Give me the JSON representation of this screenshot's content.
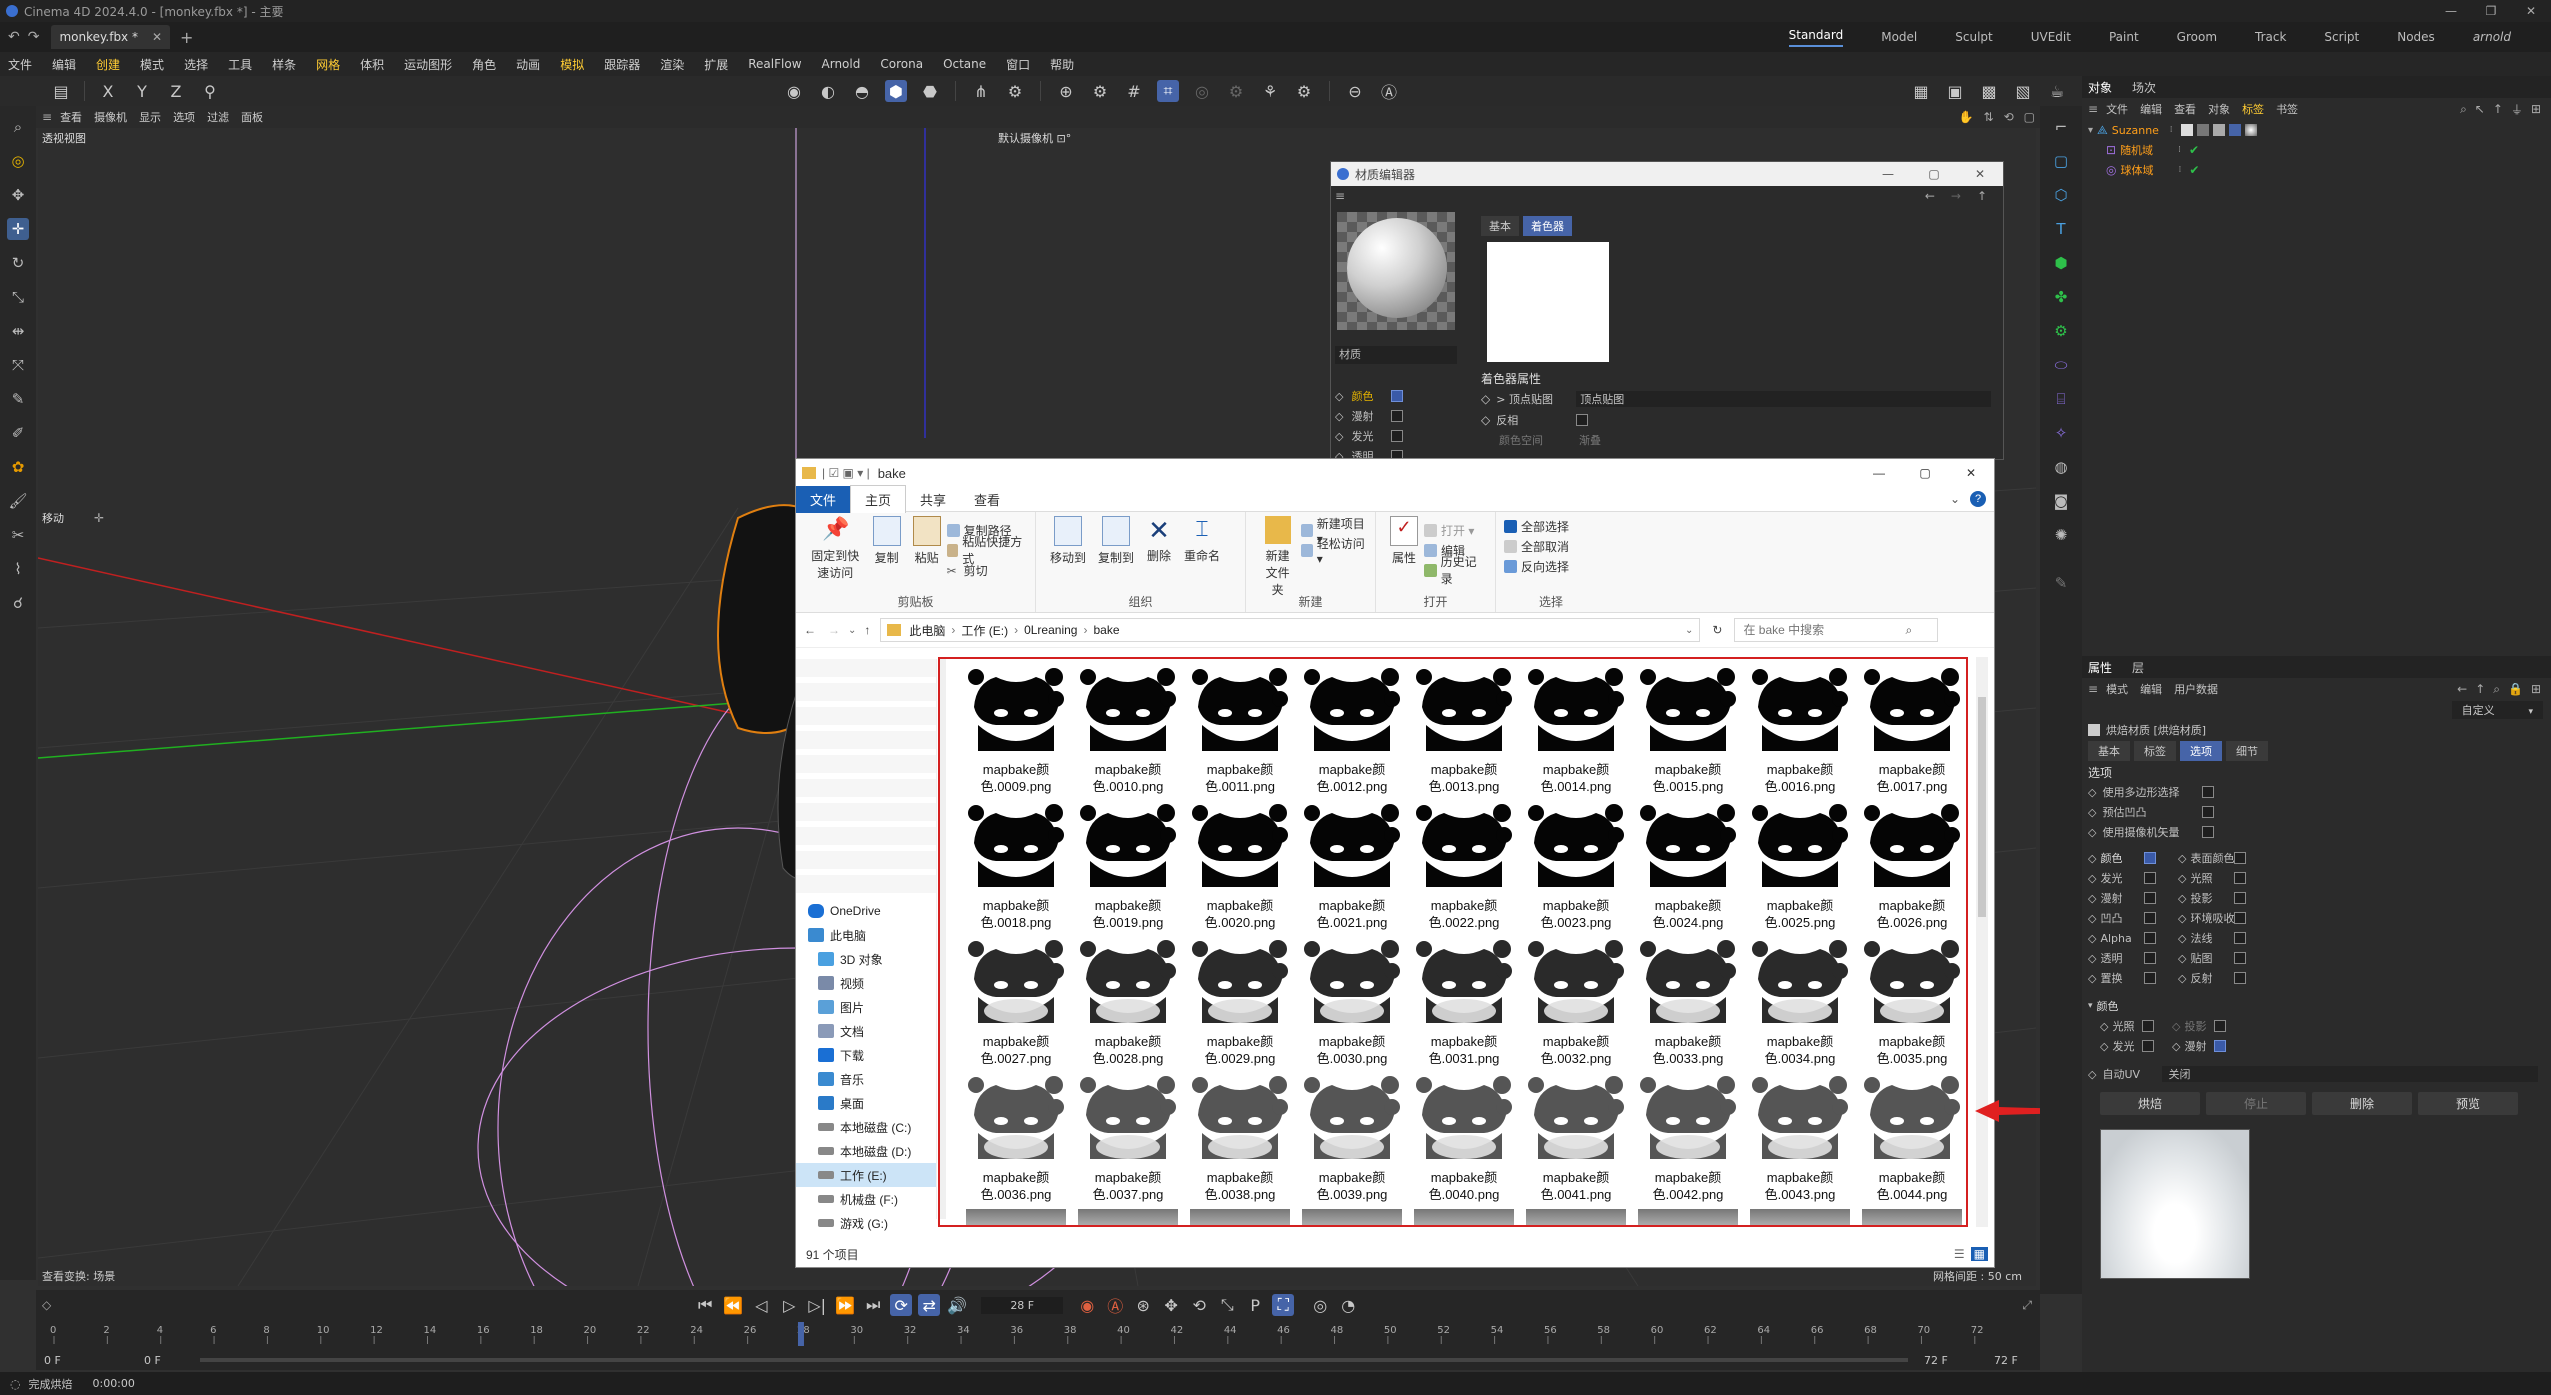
{
  "app": {
    "title": "Cinema 4D 2024.4.0 - [monkey.fbx *] - 主要",
    "doc_tab": "monkey.fbx *",
    "layouts": [
      "Standard",
      "Model",
      "Sculpt",
      "UVEdit",
      "Paint",
      "Groom",
      "Track",
      "Script",
      "Nodes",
      "arnold"
    ],
    "menu": [
      "文件",
      "编辑",
      "创建",
      "模式",
      "选择",
      "工具",
      "样条",
      "网格",
      "体积",
      "运动图形",
      "角色",
      "动画",
      "模拟",
      "跟踪器",
      "渲染",
      "扩展",
      "RealFlow",
      "Arnold",
      "Corona",
      "Octane",
      "窗口",
      "帮助"
    ]
  },
  "toolbar": {
    "axes": [
      "X",
      "Y",
      "Z"
    ]
  },
  "viewport": {
    "menu": [
      "查看",
      "摄像机",
      "显示",
      "选项",
      "过滤",
      "面板"
    ],
    "label": "透视视图",
    "camera": "默认摄像机 ⊡°",
    "move_label": "移动",
    "footer": "查看变换: 场景",
    "grid_spacing": "网格间距 : 50 cm"
  },
  "timeline": {
    "frame_field": "28 F",
    "start": "0 F",
    "start2": "0 F",
    "end": "72 F",
    "end2": "72 F",
    "ticks": [
      "0",
      "2",
      "4",
      "6",
      "8",
      "10",
      "12",
      "14",
      "16",
      "18",
      "20",
      "22",
      "24",
      "26",
      "28",
      "30",
      "32",
      "34",
      "36",
      "38",
      "40",
      "42",
      "44",
      "46",
      "48",
      "50",
      "52",
      "54",
      "56",
      "58",
      "60",
      "62",
      "64",
      "66",
      "68",
      "70",
      "72"
    ],
    "current": 28
  },
  "status": {
    "text": "完成烘焙",
    "time": "0:00:00"
  },
  "material_editor": {
    "title": "材质编辑器",
    "name": "材质",
    "tabs": [
      "基本",
      "着色器"
    ],
    "channels": [
      {
        "label": "颜色",
        "checked": true
      },
      {
        "label": "漫射",
        "checked": false
      },
      {
        "label": "发光",
        "checked": false
      },
      {
        "label": "透明",
        "checked": false
      }
    ],
    "section": "着色器属性",
    "shader_label": "> 顶点贴图",
    "shader_value": "顶点贴图",
    "invert_label": "反相",
    "extra_label": "颜色空间",
    "extra_value": "渐叠"
  },
  "explorer": {
    "title": "bake",
    "tabs": [
      "文件",
      "主页",
      "共享",
      "查看"
    ],
    "ribbon": {
      "clipboard": {
        "title": "剪贴板",
        "pin": "固定到快速访问",
        "copy": "复制",
        "paste": "粘贴",
        "copy_path": "复制路径",
        "paste_shortcut": "粘贴快捷方式",
        "cut": "剪切"
      },
      "organize": {
        "title": "组织",
        "move_to": "移动到",
        "copy_to": "复制到",
        "delete": "删除",
        "rename": "重命名"
      },
      "new": {
        "title": "新建",
        "new_folder": "新建文件夹",
        "new_item": "新建项目 ▾",
        "easy_access": "轻松访问 ▾"
      },
      "open": {
        "title": "打开",
        "properties": "属性",
        "open": "打开 ▾",
        "edit": "编辑",
        "history": "历史记录"
      },
      "select": {
        "title": "选择",
        "select_all": "全部选择",
        "select_none": "全部取消",
        "invert": "反向选择"
      }
    },
    "breadcrumb": [
      "此电脑",
      "工作 (E:)",
      "0Lreaning",
      "bake"
    ],
    "search_placeholder": "在 bake 中搜索",
    "nav": [
      "OneDrive",
      "此电脑",
      "3D 对象",
      "视频",
      "图片",
      "文档",
      "下载",
      "音乐",
      "桌面",
      "本地磁盘 (C:)",
      "本地磁盘 (D:)",
      "工作 (E:)",
      "机械盘 (F:)",
      "游戏 (G:)"
    ],
    "item_count": "91 个项目",
    "files": [
      "mapbake颜色.0009.png",
      "mapbake颜色.0010.png",
      "mapbake颜色.0011.png",
      "mapbake颜色.0012.png",
      "mapbake颜色.0013.png",
      "mapbake颜色.0014.png",
      "mapbake颜色.0015.png",
      "mapbake颜色.0016.png",
      "mapbake颜色.0017.png",
      "mapbake颜色.0018.png",
      "mapbake颜色.0019.png",
      "mapbake颜色.0020.png",
      "mapbake颜色.0021.png",
      "mapbake颜色.0022.png",
      "mapbake颜色.0023.png",
      "mapbake颜色.0024.png",
      "mapbake颜色.0025.png",
      "mapbake颜色.0026.png",
      "mapbake颜色.0027.png",
      "mapbake颜色.0028.png",
      "mapbake颜色.0029.png",
      "mapbake颜色.0030.png",
      "mapbake颜色.0031.png",
      "mapbake颜色.0032.png",
      "mapbake颜色.0033.png",
      "mapbake颜色.0034.png",
      "mapbake颜色.0035.png",
      "mapbake颜色.0036.png",
      "mapbake颜色.0037.png",
      "mapbake颜色.0038.png",
      "mapbake颜色.0039.png",
      "mapbake颜色.0040.png",
      "mapbake颜色.0041.png",
      "mapbake颜色.0042.png",
      "mapbake颜色.0043.png",
      "mapbake颜色.0044.png"
    ]
  },
  "object_manager": {
    "tabs": [
      "对象",
      "场次"
    ],
    "menu": [
      "文件",
      "编辑",
      "查看",
      "对象",
      "标签",
      "书签"
    ],
    "objects": [
      {
        "name": "Suzanne",
        "color": "#ff9f1a"
      },
      {
        "name": "随机域",
        "color": "#ff9f1a"
      },
      {
        "name": "球体域",
        "color": "#ff9f1a"
      }
    ]
  },
  "attributes": {
    "tabs": [
      "属性",
      "层"
    ],
    "menu": [
      "模式",
      "编辑",
      "用户数据"
    ],
    "custom": "自定义",
    "title": "烘焙材质 [烘焙材质]",
    "subtabs": [
      "基本",
      "标签",
      "选项",
      "细节"
    ],
    "section": "选项",
    "options": [
      "使用多边形选择",
      "预估凹凸",
      "使用摄像机矢量"
    ],
    "channels_left": [
      {
        "label": "颜色",
        "checked": true
      },
      {
        "label": "发光",
        "checked": false
      },
      {
        "label": "漫射",
        "checked": false
      },
      {
        "label": "凹凸",
        "checked": false
      },
      {
        "label": "Alpha",
        "checked": false
      },
      {
        "label": "透明",
        "checked": false
      },
      {
        "label": "置换",
        "checked": false
      }
    ],
    "channels_right": [
      {
        "label": "表面颜色",
        "checked": false
      },
      {
        "label": "光照",
        "checked": false
      },
      {
        "label": "投影",
        "checked": false
      },
      {
        "label": "环境吸收",
        "checked": false
      },
      {
        "label": "法线",
        "checked": false
      },
      {
        "label": "贴图",
        "checked": false
      },
      {
        "label": "反射",
        "checked": false
      }
    ],
    "color_section": "颜色",
    "color_opts": [
      {
        "label": "光照",
        "checked": false
      },
      {
        "label": "投影",
        "checked": false
      },
      {
        "label": "发光",
        "checked": false
      },
      {
        "label": "漫射",
        "checked": true
      }
    ],
    "auto_uv_label": "自动UV",
    "auto_uv_value": "关闭",
    "buttons": [
      "烘焙",
      "停止",
      "删除",
      "预览"
    ]
  },
  "colors": {
    "accent": "#4664a8",
    "highlight_box": "#d42020",
    "arrow": "#e02020",
    "object_orange": "#ff9f1a"
  }
}
